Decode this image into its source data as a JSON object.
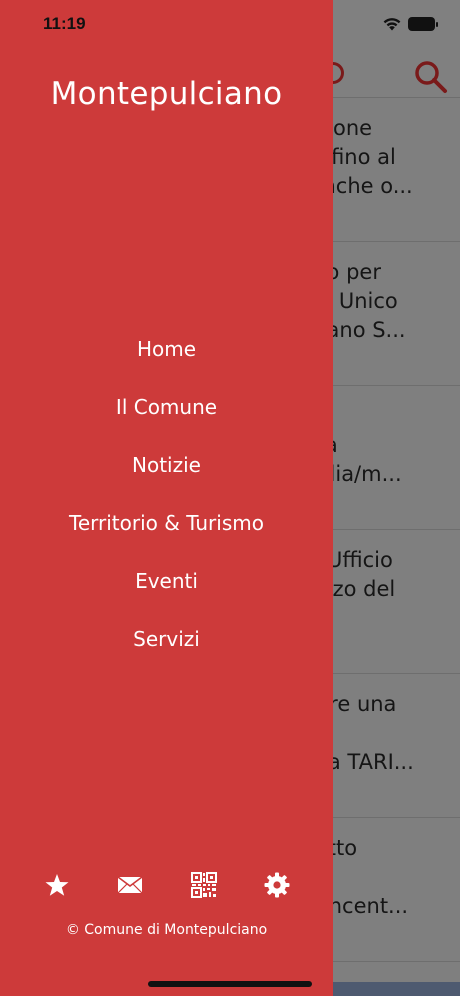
{
  "status_bar": {
    "time": "11:19"
  },
  "drawer": {
    "title": "Montepulciano",
    "menu": [
      {
        "label": "Home"
      },
      {
        "label": "Il Comune"
      },
      {
        "label": "Notizie"
      },
      {
        "label": "Territorio & Turismo"
      },
      {
        "label": "Eventi"
      },
      {
        "label": "Servizi"
      }
    ],
    "icons": [
      "star-icon",
      "mail-icon",
      "qr-code-icon",
      "gear-icon"
    ],
    "copyright": "© Comune di Montepulciano",
    "colors": {
      "background": "#cd3a3a",
      "text": "#ffffff"
    }
  },
  "background_list": {
    "rows": [
      {
        "text": "ensione\nnto fino al\ne anche o..."
      },
      {
        "text": "blico per\ntore Unico\nulciano S..."
      },
      {
        "text": "nto\ngara\nstodia/m..."
      },
      {
        "text": "io l'Ufficio\nalazzo del"
      },
      {
        "text": "edere una\nea\ndalla TARI..."
      },
      {
        "text": "chetto\n\nne incent..."
      }
    ]
  }
}
